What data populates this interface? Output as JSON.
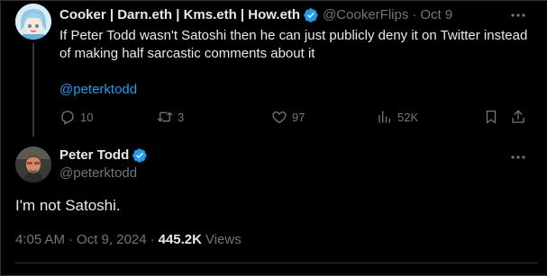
{
  "reply_to_tweet": {
    "author_name": "Cooker | Darn.eth | Kms.eth | How.eth",
    "handle": "@CookerFlips",
    "separator": "·",
    "date": "Oct 9",
    "text": "If Peter Todd wasn't Satoshi then he can just publicly deny it on Twitter instead of making half sarcastic comments about it",
    "mention": "@peterktodd",
    "replies": "10",
    "retweets": "3",
    "likes": "97",
    "views": "52K",
    "verified_color": "#1d9bf0"
  },
  "main_tweet": {
    "author_name": "Peter Todd",
    "handle": "@peterktodd",
    "text": "I'm not Satoshi.",
    "time": "4:05 AM",
    "dot1": "·",
    "date": "Oct 9, 2024",
    "dot2": "·",
    "views_count": "445.2K",
    "views_label": "Views"
  },
  "colors": {
    "background": "#000000",
    "text_primary": "#e7e9ea",
    "text_secondary": "#71767b",
    "accent": "#1d9bf0",
    "border": "#2f3336"
  }
}
